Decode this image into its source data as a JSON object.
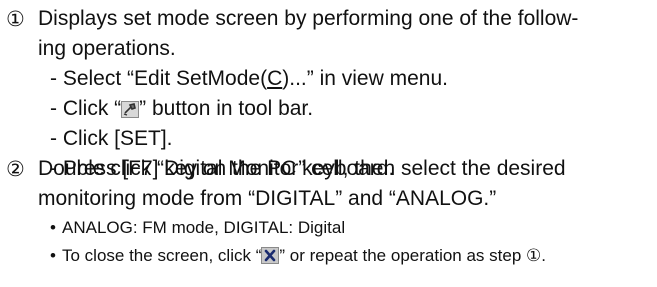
{
  "step1": {
    "number": "①",
    "line1": "Displays set mode screen by performing one of the follow-",
    "line2": "ing operations.",
    "items": {
      "a_pre": "- Select “Edit SetMode(",
      "a_key": "C",
      "a_post": ")...” in view menu.",
      "b_pre": "- Click “",
      "b_icon": "set-mode-toolbar-icon",
      "b_post": "” button in tool bar.",
      "c": "- Click [SET].",
      "d": "- Press [F7] key on the PC keyboard."
    }
  },
  "step2": {
    "number": "②",
    "line1": "Double click “Digital Monitor” cell, then select the desired",
    "line2": "monitoring mode from “DIGITAL” and “ANALOG.”",
    "bullets": {
      "b1": "ANALOG: FM mode, DIGITAL: Digital",
      "b2_pre": "To close the screen, click “",
      "b2_icon": "close-icon",
      "b2_post": "” or repeat the operation as step ①."
    }
  }
}
